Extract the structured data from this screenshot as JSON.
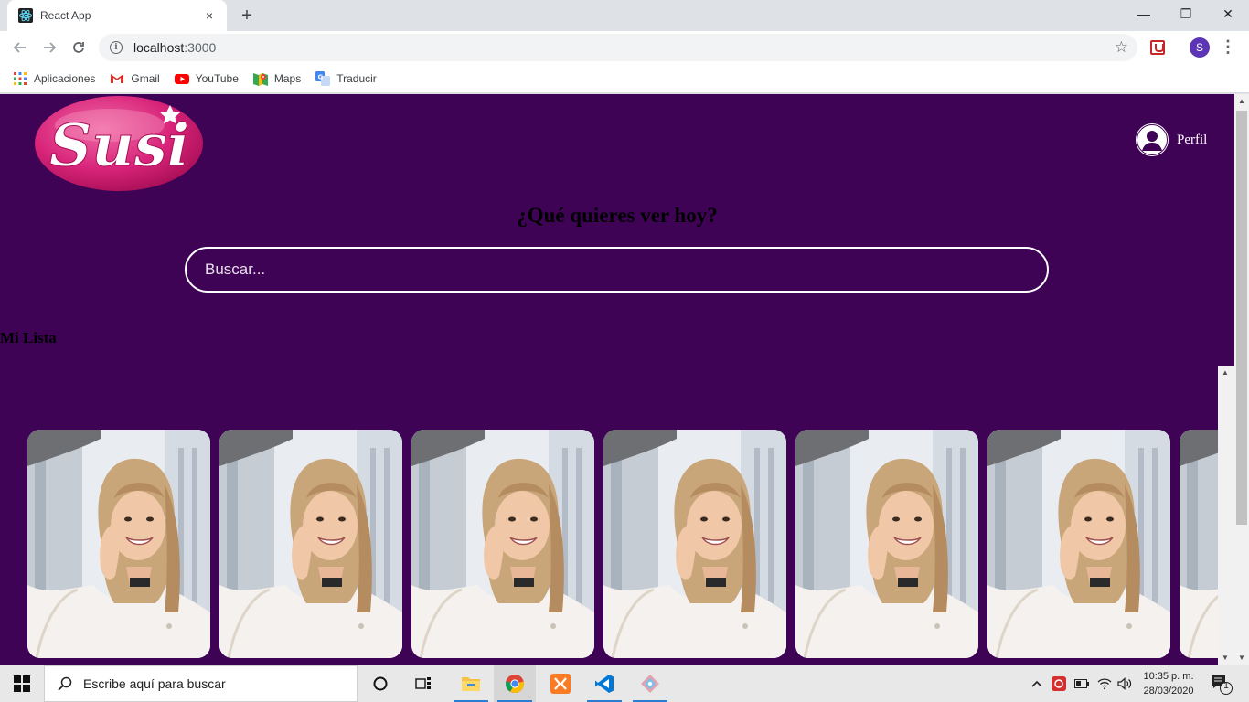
{
  "browser": {
    "tab_title": "React App",
    "tab_close": "×",
    "new_tab": "+",
    "url_host": "localhost",
    "url_port": ":3000",
    "profile_initial": "S",
    "window_controls": {
      "minimize": "—",
      "restore": "❐",
      "close": "✕"
    }
  },
  "bookmarks": [
    {
      "label": "Aplicaciones",
      "icon": "apps-grid-icon"
    },
    {
      "label": "Gmail",
      "icon": "gmail-icon"
    },
    {
      "label": "YouTube",
      "icon": "youtube-icon"
    },
    {
      "label": "Maps",
      "icon": "maps-icon"
    },
    {
      "label": "Traducir",
      "icon": "translate-icon"
    }
  ],
  "page": {
    "logo_text": "Susi",
    "profile_label": "Perfil",
    "headline": "¿Qué quieres ver hoy?",
    "search_placeholder": "Buscar...",
    "list_title": "Mi Lista",
    "card_count_visible": 7,
    "colors": {
      "background": "#3e0355",
      "logo_pink": "#d8247a",
      "text": "#000000"
    }
  },
  "taskbar": {
    "search_placeholder": "Escribe aquí para buscar",
    "apps": [
      "task-view",
      "file-explorer",
      "chrome",
      "xampp",
      "vscode",
      "git-kraken"
    ],
    "time": "10:35 p. m.",
    "date": "28/03/2020",
    "notification_count": "1"
  }
}
